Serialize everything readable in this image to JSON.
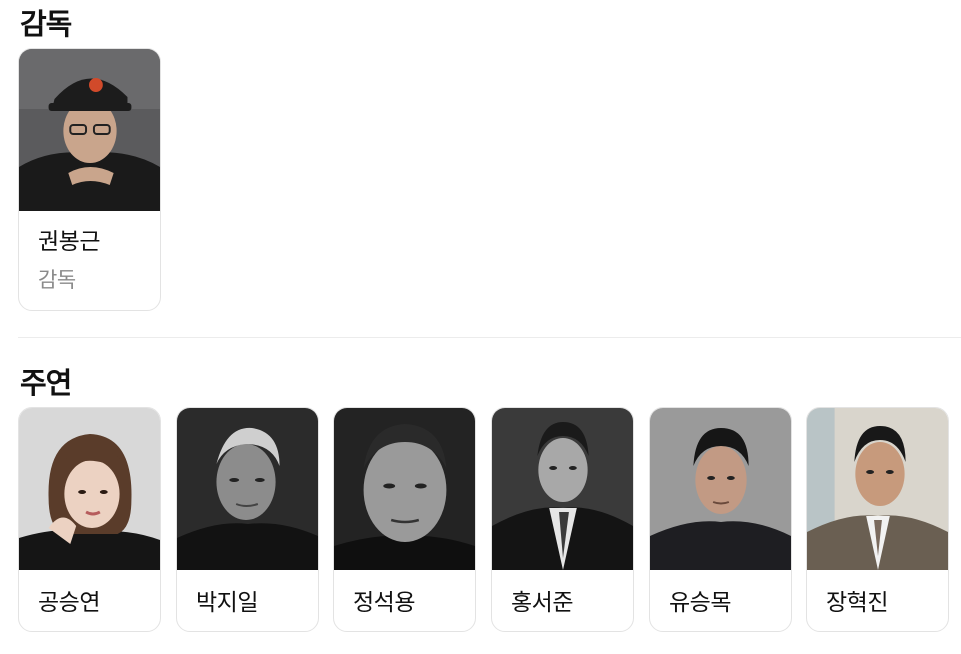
{
  "director_section": {
    "title": "감독",
    "people": [
      {
        "name": "권봉근",
        "role": "감독"
      }
    ]
  },
  "cast_section": {
    "title": "주연",
    "people": [
      {
        "name": "공승연"
      },
      {
        "name": "박지일"
      },
      {
        "name": "정석용"
      },
      {
        "name": "홍서준"
      },
      {
        "name": "유승목"
      },
      {
        "name": "장혁진"
      }
    ]
  }
}
